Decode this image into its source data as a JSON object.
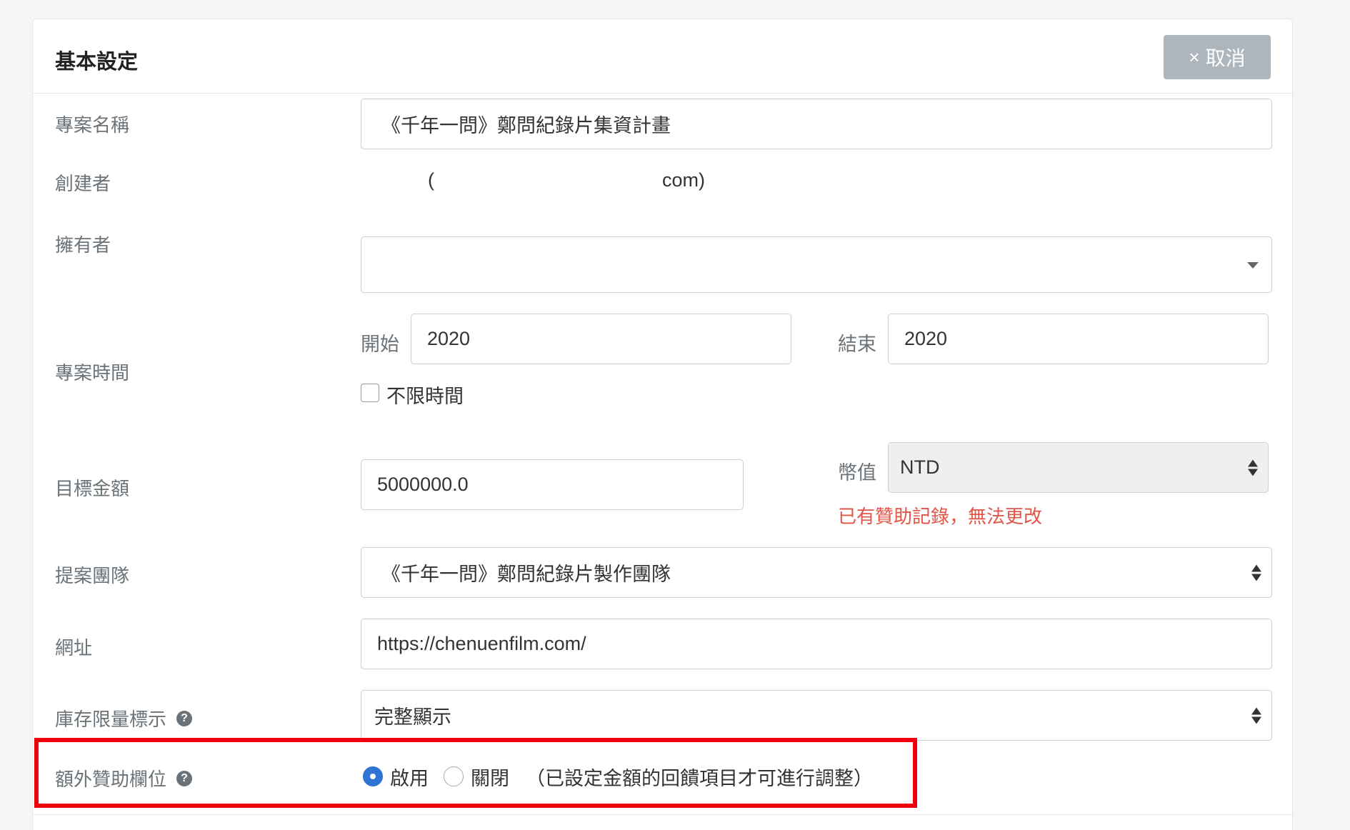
{
  "header": {
    "title": "基本設定",
    "cancel_label": "取消",
    "cancel_icon": "close-icon"
  },
  "fields": {
    "project_name": {
      "label": "專案名稱",
      "value": "《千年一問》鄭問紀錄片集資計畫"
    },
    "creator": {
      "label": "創建者",
      "open": "(",
      "email_suffix": "com)"
    },
    "owner": {
      "label": "擁有者",
      "value": ""
    },
    "period": {
      "label": "專案時間",
      "start_label": "開始",
      "start_value": "2020",
      "end_label": "結束",
      "end_value": "2020",
      "unlimited_label": "不限時間",
      "unlimited_checked": false
    },
    "goal": {
      "label": "目標金額",
      "value": "5000000.0",
      "currency_label": "幣值",
      "currency_value": "NTD",
      "currency_error": "已有贊助記錄，無法更改"
    },
    "team": {
      "label": "提案團隊",
      "value": "《千年一問》鄭問紀錄片製作團隊"
    },
    "url": {
      "label": "網址",
      "value": "https://chenuenfilm.com/"
    },
    "stock_display": {
      "label": "庫存限量標示",
      "value": "完整顯示"
    },
    "extra_support": {
      "label": "額外贊助欄位",
      "enable_label": "啟用",
      "disable_label": "關閉",
      "note": "（已設定金額的回饋項目才可進行調整）",
      "selected": "enable"
    }
  },
  "colors": {
    "accent": "#2f73d6",
    "error": "#e05546",
    "highlight": "#f0000a",
    "cancel_bg": "#aeb6bd"
  }
}
